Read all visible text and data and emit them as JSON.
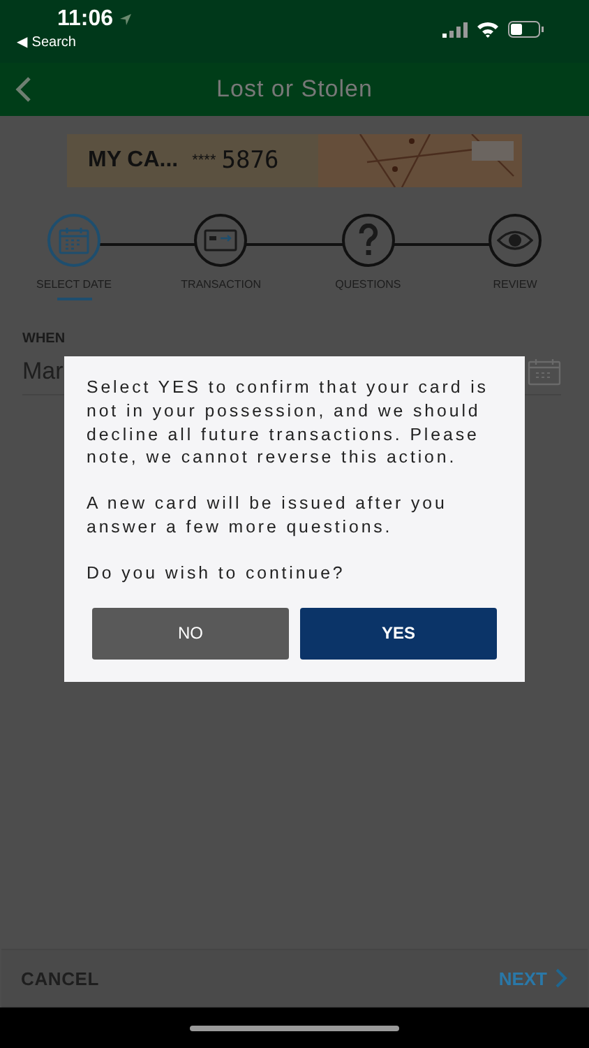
{
  "status_bar": {
    "time": "11:06",
    "back_label": "◀ Search"
  },
  "header": {
    "title": "Lost or Stolen"
  },
  "card": {
    "name": "MY CA...",
    "mask": "****",
    "last_digits": "5876"
  },
  "steps": [
    {
      "label": "SELECT DATE",
      "kind": "calendar",
      "selected": true
    },
    {
      "label": "TRANSACTION",
      "kind": "card",
      "selected": false
    },
    {
      "label": "QUESTIONS",
      "kind": "question",
      "selected": false
    },
    {
      "label": "REVIEW",
      "kind": "eye",
      "selected": false
    }
  ],
  "date_section": {
    "label": "WHEN",
    "value": "Mar"
  },
  "dialog": {
    "paragraphs": [
      "Select YES to confirm that your card is not in your possession, and we should decline all future transactions. Please note, we cannot reverse this action.",
      "A new card will be issued after you answer a few more questions.",
      "Do you wish to continue?"
    ],
    "buttons": [
      {
        "label": "NO",
        "kind": "secondary"
      },
      {
        "label": "YES",
        "kind": "primary"
      }
    ]
  },
  "footer": {
    "cancel": "CANCEL",
    "next": "NEXT"
  }
}
